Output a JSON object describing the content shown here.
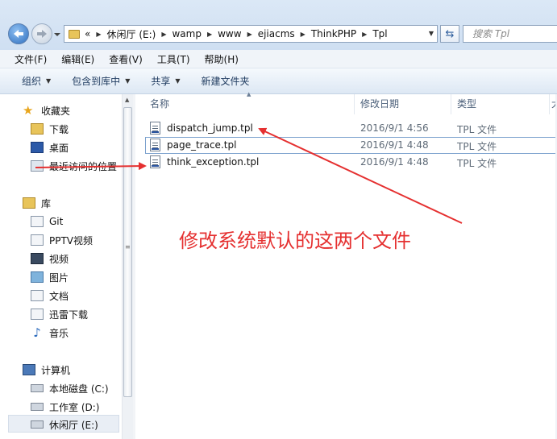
{
  "address_bar": {
    "overflow": "«",
    "breadcrumbs": [
      "休闲厅 (E:)",
      "wamp",
      "www",
      "ejiacms",
      "ThinkPHP",
      "Tpl"
    ],
    "search_placeholder": "搜索 Tpl"
  },
  "menu": [
    "文件(F)",
    "编辑(E)",
    "查看(V)",
    "工具(T)",
    "帮助(H)"
  ],
  "toolbar": [
    "组织",
    "包含到库中",
    "共享",
    "新建文件夹"
  ],
  "sidebar": {
    "favorites": {
      "label": "收藏夹",
      "items": [
        "下载",
        "桌面",
        "最近访问的位置"
      ]
    },
    "libraries": {
      "label": "库",
      "items": [
        "Git",
        "PPTV视频",
        "视频",
        "图片",
        "文档",
        "迅雷下载",
        "音乐"
      ]
    },
    "computer": {
      "label": "计算机",
      "items": [
        "本地磁盘 (C:)",
        "工作室 (D:)",
        "休闲厅 (E:)"
      ]
    }
  },
  "columns": {
    "name": "名称",
    "date": "修改日期",
    "type": "类型",
    "size": "大"
  },
  "files": [
    {
      "name": "dispatch_jump.tpl",
      "date": "2016/9/1 4:56",
      "type": "TPL 文件"
    },
    {
      "name": "page_trace.tpl",
      "date": "2016/9/1 4:48",
      "type": "TPL 文件"
    },
    {
      "name": "think_exception.tpl",
      "date": "2016/9/1 4:48",
      "type": "TPL 文件"
    }
  ],
  "annotation": "修改系统默认的这两个文件",
  "colors": {
    "annotation": "#e53030",
    "selection_border": "#7da2ce"
  },
  "icons": [
    "back-arrow-icon",
    "forward-arrow-icon",
    "folder-icon",
    "refresh-icon",
    "star-icon",
    "download-folder-icon",
    "desktop-icon",
    "recent-places-icon",
    "library-icon",
    "computer-icon",
    "drive-icon",
    "tpl-file-icon"
  ]
}
